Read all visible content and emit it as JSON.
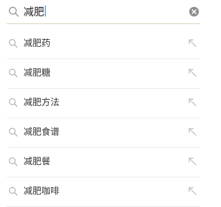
{
  "search": {
    "query": "减肥",
    "icon": "search-icon",
    "clear_icon": "clear-icon",
    "accent": "#2f74c0",
    "underline": "#d8d3b6"
  },
  "suggestions": [
    {
      "label": "减肥药"
    },
    {
      "label": "减肥糖"
    },
    {
      "label": "减肥方法"
    },
    {
      "label": "减肥食谱"
    },
    {
      "label": "减肥餐"
    },
    {
      "label": "减肥咖啡"
    }
  ],
  "row_icons": {
    "left": "search-icon",
    "right": "arrow-up-left-icon"
  }
}
